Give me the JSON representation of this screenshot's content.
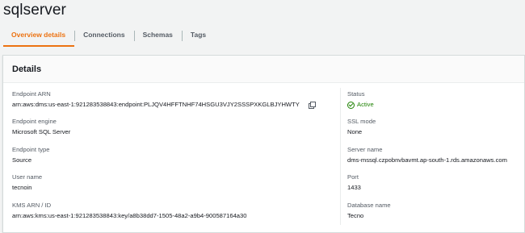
{
  "page": {
    "title": "sqlserver"
  },
  "tabs": [
    {
      "label": "Overview details"
    },
    {
      "label": "Connections"
    },
    {
      "label": "Schemas"
    },
    {
      "label": "Tags"
    }
  ],
  "details": {
    "heading": "Details",
    "left": [
      {
        "label": "Endpoint ARN",
        "value": "arn:aws:dms:us-east-1:921283538843:endpoint:PLJQV4HFFTNHF74HSGU3VJY2SSSPXKGLBJYHWTY",
        "copy_icon": "copy-icon"
      },
      {
        "label": "Endpoint engine",
        "value": "Microsoft SQL Server"
      },
      {
        "label": "Endpoint type",
        "value": "Source"
      },
      {
        "label": "User name",
        "value": "tecnoin"
      },
      {
        "label": "KMS ARN / ID",
        "value": "arn:aws:kms:us-east-1:921283538843:key/a8b38dd7-1505-48a2-a9b4-900587164a30"
      }
    ],
    "right": [
      {
        "label": "Status",
        "value": "Active",
        "icon": "check-circle-icon",
        "color": "#1d8102"
      },
      {
        "label": "SSL mode",
        "value": "None"
      },
      {
        "label": "Server name",
        "value": "dms-mssql.czpobnvbavmt.ap-south-1.rds.amazonaws.com"
      },
      {
        "label": "Port",
        "value": "1433"
      },
      {
        "label": "Database name",
        "value": "Tecno"
      }
    ]
  },
  "colors": {
    "accent": "#ec7211",
    "success": "#1d8102"
  }
}
